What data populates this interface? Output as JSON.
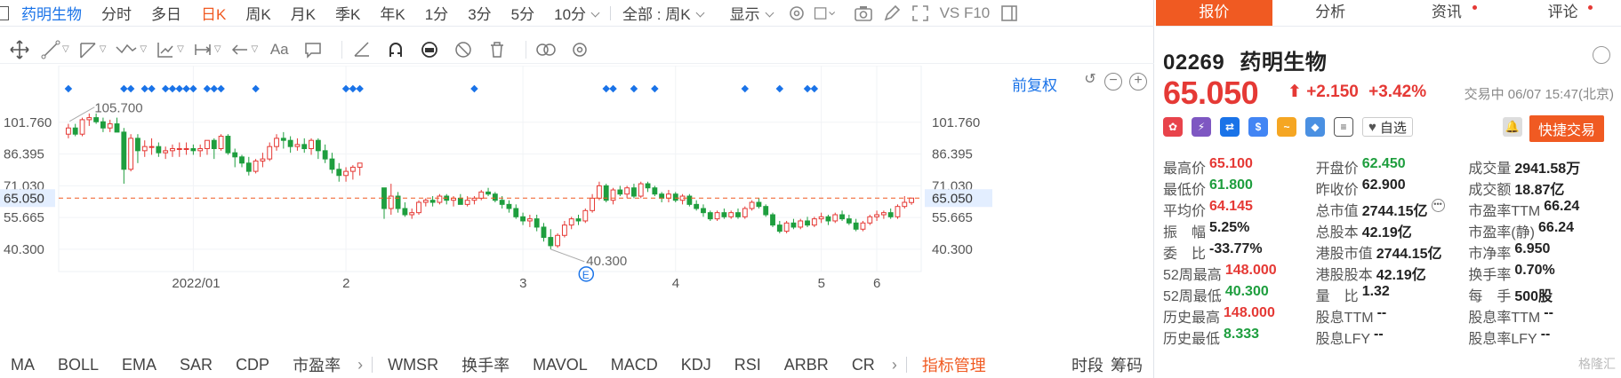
{
  "stock": {
    "name": "药明生物",
    "code": "02269",
    "price": "65.050",
    "change": "+2.150",
    "change_pct": "+3.42%",
    "status_time": "交易中 06/07 15:47(北京)"
  },
  "top_tabs": [
    "分时",
    "多日",
    "日K",
    "周K",
    "月K",
    "季K",
    "年K",
    "1分",
    "3分",
    "5分",
    "10分"
  ],
  "active_tab": "日K",
  "period_select": "全部 : 周K",
  "display_select": "显示",
  "top_icons": [
    "settings-icon",
    "checkbox-icon",
    "camera-icon",
    "pencil-icon",
    "fullscreen-icon",
    "vs-f10-icon",
    "sidebar-icon"
  ],
  "vs_label": "VS F10",
  "toolbar_icons": [
    "move-icon",
    "line-icon",
    "channel-icon",
    "wave-icon",
    "fib-icon",
    "range-icon",
    "arrow-icon",
    "text-icon",
    "comment-icon",
    "ruler-icon",
    "magnet-icon",
    "lock-icon",
    "hide-icon",
    "trash-icon",
    "link-icon",
    "gear-icon"
  ],
  "toolbar_text": "Aa",
  "adjust_label": "前复权",
  "chart_data": {
    "type": "candlestick",
    "y_ticks": [
      "101.760",
      "86.395",
      "71.030",
      "55.665",
      "40.300"
    ],
    "y_ticks_values": [
      101.76,
      86.395,
      71.03,
      55.665,
      40.3
    ],
    "ylim": [
      29.5,
      118
    ],
    "x_labels": [
      "2022/01",
      "2",
      "3",
      "4",
      "5",
      "6"
    ],
    "current_price_label": "65.050",
    "current_price": 65.05,
    "max_label": "105.700",
    "max_value": 105.7,
    "min_label": "40.300",
    "min_value": 40.3,
    "event_marker": "E",
    "ohlc": [
      [
        96,
        101,
        94,
        99
      ],
      [
        99,
        101,
        95,
        96
      ],
      [
        96,
        104,
        95,
        103
      ],
      [
        103,
        106,
        100,
        104
      ],
      [
        104,
        106,
        101,
        102
      ],
      [
        102,
        104,
        97,
        99
      ],
      [
        99,
        103,
        97,
        101
      ],
      [
        101,
        104,
        98,
        97
      ],
      [
        97,
        99,
        72,
        79
      ],
      [
        79,
        96,
        78,
        94
      ],
      [
        94,
        96,
        82,
        88
      ],
      [
        88,
        93,
        85,
        90
      ],
      [
        90,
        94,
        86,
        90
      ],
      [
        90,
        92,
        85,
        87
      ],
      [
        87,
        90,
        84,
        88
      ],
      [
        88,
        91,
        85,
        89
      ],
      [
        89,
        92,
        85,
        89
      ],
      [
        89,
        92,
        86,
        89
      ],
      [
        89,
        91,
        86,
        88
      ],
      [
        88,
        91,
        85,
        89
      ],
      [
        89,
        93,
        86,
        93
      ],
      [
        93,
        94,
        84,
        89
      ],
      [
        89,
        96,
        88,
        95
      ],
      [
        95,
        96,
        86,
        87
      ],
      [
        87,
        89,
        80,
        85
      ],
      [
        85,
        86,
        80,
        82
      ],
      [
        82,
        85,
        76,
        78
      ],
      [
        78,
        84,
        77,
        83
      ],
      [
        83,
        87,
        80,
        84
      ],
      [
        84,
        92,
        83,
        90
      ],
      [
        90,
        96,
        88,
        94
      ],
      [
        94,
        97,
        89,
        93
      ],
      [
        93,
        95,
        87,
        90
      ],
      [
        90,
        94,
        88,
        91
      ],
      [
        91,
        94,
        87,
        89
      ],
      [
        89,
        94,
        86,
        93
      ],
      [
        93,
        94,
        84,
        88
      ],
      [
        88,
        91,
        82,
        84
      ],
      [
        84,
        87,
        77,
        79
      ],
      [
        79,
        82,
        73,
        76
      ],
      [
        76,
        80,
        73,
        78
      ],
      [
        78,
        81,
        74,
        80
      ],
      [
        80,
        82,
        76,
        82
      ],
      [
        70,
        70,
        55,
        60
      ],
      [
        60,
        72,
        57,
        66
      ],
      [
        66,
        68,
        58,
        60
      ],
      [
        60,
        63,
        56,
        57
      ],
      [
        57,
        60,
        55,
        58
      ],
      [
        58,
        64,
        57,
        63
      ],
      [
        63,
        65,
        61,
        64
      ],
      [
        64,
        66,
        61,
        63
      ],
      [
        63,
        67,
        62,
        66
      ],
      [
        66,
        67,
        62,
        64
      ],
      [
        64,
        66,
        61,
        65
      ],
      [
        65,
        67,
        62,
        62
      ],
      [
        62,
        66,
        61,
        64
      ],
      [
        64,
        66,
        62,
        65
      ],
      [
        65,
        69,
        64,
        68
      ],
      [
        68,
        70,
        66,
        67
      ],
      [
        67,
        68,
        63,
        64
      ],
      [
        64,
        66,
        60,
        62
      ],
      [
        62,
        64,
        58,
        60
      ],
      [
        60,
        62,
        55,
        56
      ],
      [
        56,
        58,
        52,
        54
      ],
      [
        54,
        57,
        51,
        55
      ],
      [
        55,
        57,
        49,
        51
      ],
      [
        51,
        53,
        44,
        46
      ],
      [
        46,
        50,
        40.3,
        42
      ],
      [
        42,
        48,
        41,
        47
      ],
      [
        47,
        54,
        46,
        52
      ],
      [
        52,
        56,
        50,
        55
      ],
      [
        55,
        57,
        52,
        54
      ],
      [
        54,
        60,
        53,
        59
      ],
      [
        59,
        67,
        58,
        65
      ],
      [
        65,
        73,
        64,
        71
      ],
      [
        71,
        72,
        63,
        64
      ],
      [
        64,
        70,
        62,
        69
      ],
      [
        69,
        71,
        66,
        67
      ],
      [
        67,
        71,
        65,
        70
      ],
      [
        70,
        72,
        65,
        66
      ],
      [
        66,
        73,
        65,
        72
      ],
      [
        72,
        73,
        68,
        70
      ],
      [
        70,
        71,
        66,
        67
      ],
      [
        67,
        68,
        63,
        65
      ],
      [
        65,
        69,
        63,
        67
      ],
      [
        67,
        68,
        63,
        64
      ],
      [
        64,
        67,
        62,
        66
      ],
      [
        66,
        67,
        61,
        62
      ],
      [
        62,
        64,
        59,
        60
      ],
      [
        60,
        62,
        56,
        58
      ],
      [
        58,
        59,
        54,
        55
      ],
      [
        55,
        59,
        54,
        58
      ],
      [
        58,
        60,
        55,
        56
      ],
      [
        56,
        59,
        55,
        58
      ],
      [
        58,
        60,
        55,
        56
      ],
      [
        56,
        61,
        55,
        60
      ],
      [
        60,
        64,
        59,
        63
      ],
      [
        63,
        65,
        60,
        61
      ],
      [
        61,
        62,
        56,
        57
      ],
      [
        57,
        58,
        51,
        52
      ],
      [
        52,
        54,
        48,
        49
      ],
      [
        49,
        54,
        48,
        53
      ],
      [
        53,
        55,
        50,
        51
      ],
      [
        51,
        55,
        50,
        54
      ],
      [
        54,
        56,
        51,
        52
      ],
      [
        52,
        56,
        51,
        55
      ],
      [
        55,
        58,
        53,
        56
      ],
      [
        56,
        57,
        52,
        54
      ],
      [
        54,
        58,
        53,
        57
      ],
      [
        57,
        59,
        54,
        55
      ],
      [
        55,
        57,
        52,
        53
      ],
      [
        53,
        55,
        49,
        50
      ],
      [
        50,
        54,
        49,
        53
      ],
      [
        53,
        57,
        52,
        56
      ],
      [
        56,
        59,
        54,
        57
      ],
      [
        57,
        59,
        55,
        58
      ],
      [
        58,
        60,
        55,
        56
      ],
      [
        56,
        62,
        55,
        61
      ],
      [
        61,
        66,
        60,
        63
      ],
      [
        62.9,
        65.1,
        61.8,
        65.05
      ]
    ],
    "gap_after_index": 42,
    "events_x": [
      0,
      8,
      9,
      11,
      12,
      14,
      15,
      16,
      17,
      18,
      20,
      21,
      22,
      27,
      40,
      41,
      42,
      56,
      75,
      76,
      79,
      82,
      95,
      100,
      104,
      105
    ]
  },
  "indicators": [
    "MA",
    "BOLL",
    "EMA",
    "SAR",
    "CDP",
    "市盈率",
    "WMSR",
    "换手率",
    "MAVOL",
    "MACD",
    "KDJ",
    "RSI",
    "ARBR",
    "CR"
  ],
  "indicator_manage": "指标管理",
  "indicator_right": [
    "时段",
    "筹码"
  ],
  "right_tabs": [
    "报价",
    "分析",
    "资讯",
    "评论"
  ],
  "active_right_tab": "报价",
  "watch_label": "自选",
  "quick_trade": "快捷交易",
  "stats": [
    [
      {
        "k": "最高价",
        "v": "65.100",
        "c": "up"
      },
      {
        "k": "开盘价",
        "v": "62.450",
        "c": "down"
      },
      {
        "k": "成交量",
        "v": "2941.58万",
        "c": ""
      }
    ],
    [
      {
        "k": "最低价",
        "v": "61.800",
        "c": "down"
      },
      {
        "k": "昨收价",
        "v": "62.900",
        "c": ""
      },
      {
        "k": "成交额",
        "v": "18.87亿",
        "c": ""
      }
    ],
    [
      {
        "k": "平均价",
        "v": "64.145",
        "c": "up"
      },
      {
        "k": "总市值",
        "v": "2744.15亿",
        "c": ""
      },
      {
        "k": "市盈率TTM",
        "v": "66.24",
        "c": ""
      }
    ],
    [
      {
        "k": "振　幅",
        "v": "5.25%",
        "c": ""
      },
      {
        "k": "总股本",
        "v": "42.19亿",
        "c": ""
      },
      {
        "k": "市盈率(静)",
        "v": "66.24",
        "c": ""
      }
    ],
    [
      {
        "k": "委　比",
        "v": "-33.77%",
        "c": ""
      },
      {
        "k": "港股市值",
        "v": "2744.15亿",
        "c": ""
      },
      {
        "k": "市净率",
        "v": "6.950",
        "c": ""
      }
    ],
    [
      {
        "k": "52周最高",
        "v": "148.000",
        "c": "up"
      },
      {
        "k": "港股股本",
        "v": "42.19亿",
        "c": ""
      },
      {
        "k": "换手率",
        "v": "0.70%",
        "c": ""
      }
    ],
    [
      {
        "k": "52周最低",
        "v": "40.300",
        "c": "down"
      },
      {
        "k": "量　比",
        "v": "1.32",
        "c": ""
      },
      {
        "k": "每　手",
        "v": "500股",
        "c": ""
      }
    ],
    [
      {
        "k": "历史最高",
        "v": "148.000",
        "c": "up"
      },
      {
        "k": "股息TTM",
        "v": "--",
        "c": ""
      },
      {
        "k": "股息率TTM",
        "v": "--",
        "c": ""
      }
    ],
    [
      {
        "k": "历史最低",
        "v": "8.333",
        "c": "down"
      },
      {
        "k": "股息LFY",
        "v": "--",
        "c": ""
      },
      {
        "k": "股息率LFY",
        "v": "--",
        "c": ""
      }
    ]
  ],
  "watermark": "格隆汇",
  "colors": {
    "up": "#e53935",
    "down": "#1e9e3e",
    "accent": "#f05a22",
    "link": "#1a73e8",
    "event": "#1a73e8"
  }
}
